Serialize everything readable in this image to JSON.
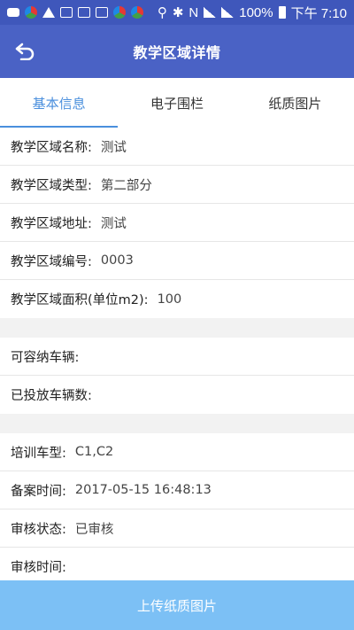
{
  "status_bar": {
    "battery": "100%",
    "time": "下午 7:10"
  },
  "header": {
    "title": "教学区域详情"
  },
  "tabs": [
    {
      "label": "基本信息"
    },
    {
      "label": "电子围栏"
    },
    {
      "label": "纸质图片"
    }
  ],
  "groups": [
    {
      "rows": [
        {
          "label": "教学区域名称:",
          "value": "测试"
        },
        {
          "label": "教学区域类型:",
          "value": "第二部分"
        },
        {
          "label": "教学区域地址:",
          "value": "测试"
        },
        {
          "label": "教学区域编号:",
          "value": "0003"
        },
        {
          "label": "教学区域面积(单位m2):",
          "value": "100"
        }
      ]
    },
    {
      "rows": [
        {
          "label": "可容纳车辆:",
          "value": ""
        },
        {
          "label": "已投放车辆数:",
          "value": ""
        }
      ]
    },
    {
      "rows": [
        {
          "label": "培训车型:",
          "value": "C1,C2"
        },
        {
          "label": "备案时间:",
          "value": "2017-05-15 16:48:13"
        },
        {
          "label": "审核状态:",
          "value": "已审核"
        },
        {
          "label": "审核时间:",
          "value": ""
        }
      ]
    }
  ],
  "bottom_button": {
    "label": "上传纸质图片"
  },
  "colors": {
    "appbar": "#4a62c5",
    "active_tab": "#4a8fdd",
    "bottom_button": "#7cc0f5"
  }
}
